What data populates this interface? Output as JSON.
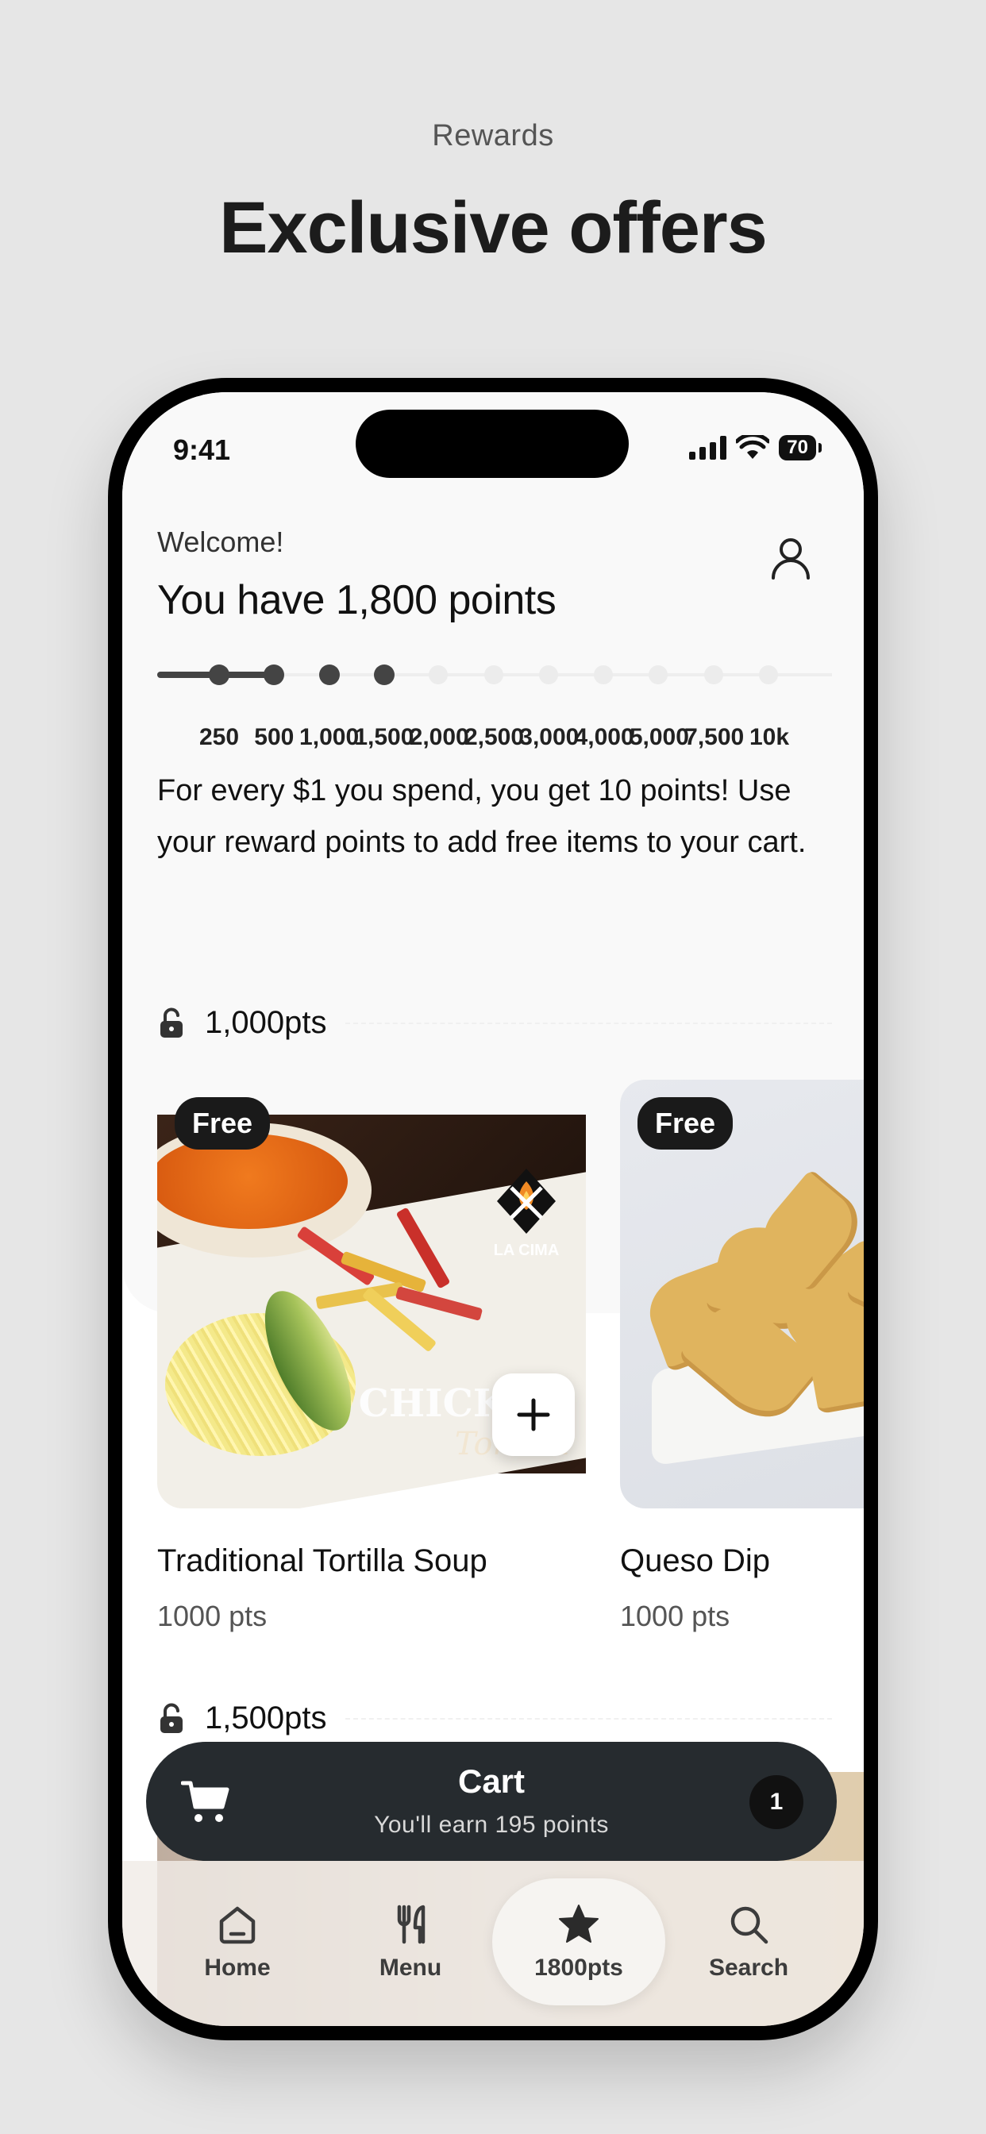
{
  "page": {
    "eyebrow": "Rewards",
    "headline": "Exclusive offers"
  },
  "status": {
    "time": "9:41",
    "battery": "70"
  },
  "header": {
    "welcome": "Welcome!",
    "points_title": "You have 1,800 points",
    "progress": {
      "current_points": 1800,
      "milestones": [
        "250",
        "500",
        "1,000",
        "1,500",
        "2,000",
        "2,500",
        "3,000",
        "4,000",
        "5,000",
        "7,500",
        "10k"
      ]
    },
    "info": "For every $1 you spend, you get 10 points! Use your reward points to add free items to your cart."
  },
  "tiers": [
    {
      "label": "1,000pts",
      "items": [
        {
          "badge": "Free",
          "name": "Traditional Tortilla Soup",
          "pts": "1000 pts",
          "image_text_1": "LA CIMA",
          "image_text_2": "CHICKEN",
          "image_text_3": "Tortilla"
        },
        {
          "badge": "Free",
          "name": "Queso Dip",
          "pts": "1000 pts"
        }
      ]
    },
    {
      "label": "1,500pts"
    }
  ],
  "cart": {
    "title": "Cart",
    "subtitle": "You'll earn 195 points",
    "count": "1"
  },
  "tabs": [
    {
      "label": "Home",
      "icon": "home-icon"
    },
    {
      "label": "Menu",
      "icon": "utensils-icon"
    },
    {
      "label": "1800pts",
      "icon": "star-icon",
      "active": true
    },
    {
      "label": "Search",
      "icon": "search-icon"
    }
  ],
  "colors": {
    "background": "#e6e6e6",
    "accent_dark": "#262b2f",
    "badge": "#1a1a1a"
  }
}
